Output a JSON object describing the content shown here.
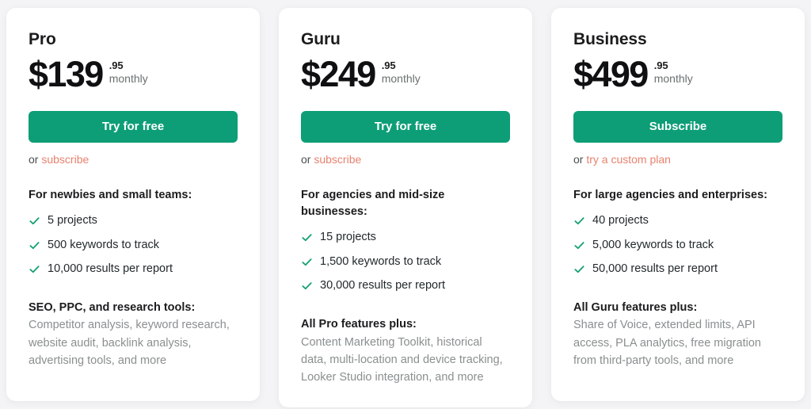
{
  "theme": {
    "page_background": "#f4f4f6",
    "card_background": "#ffffff",
    "cta_color": "#0d9e77",
    "link_color": "#e8826e",
    "check_color": "#14a06f",
    "muted_text_color": "#8a8f8f"
  },
  "plans": [
    {
      "name": "Pro",
      "price": "$139",
      "cents": ".95",
      "period": "monthly",
      "cta_label": "Try for free",
      "secondary_prefix": "or",
      "secondary_link": "subscribe",
      "audience": "For newbies and small teams:",
      "features": [
        "5 projects",
        "500 keywords to track",
        "10,000 results per report"
      ],
      "extras_title": "SEO, PPC, and research tools:",
      "extras_text": "Competitor analysis, keyword research, website audit, backlink analysis, advertising tools, and more"
    },
    {
      "name": "Guru",
      "price": "$249",
      "cents": ".95",
      "period": "monthly",
      "cta_label": "Try for free",
      "secondary_prefix": "or",
      "secondary_link": "subscribe",
      "audience": "For agencies and mid-size businesses:",
      "features": [
        "15 projects",
        "1,500 keywords to track",
        "30,000 results per report"
      ],
      "extras_title": "All Pro features plus:",
      "extras_text": "Content Marketing Toolkit, historical data, multi-location and device tracking, Looker Studio integration, and more"
    },
    {
      "name": "Business",
      "price": "$499",
      "cents": ".95",
      "period": "monthly",
      "cta_label": "Subscribe",
      "secondary_prefix": "or",
      "secondary_link": "try a custom plan",
      "audience": "For large agencies and enterprises:",
      "features": [
        "40 projects",
        "5,000 keywords to track",
        "50,000 results per report"
      ],
      "extras_title": "All Guru features plus:",
      "extras_text": "Share of Voice, extended limits, API access, PLA analytics, free migration from third-party tools, and more"
    }
  ]
}
